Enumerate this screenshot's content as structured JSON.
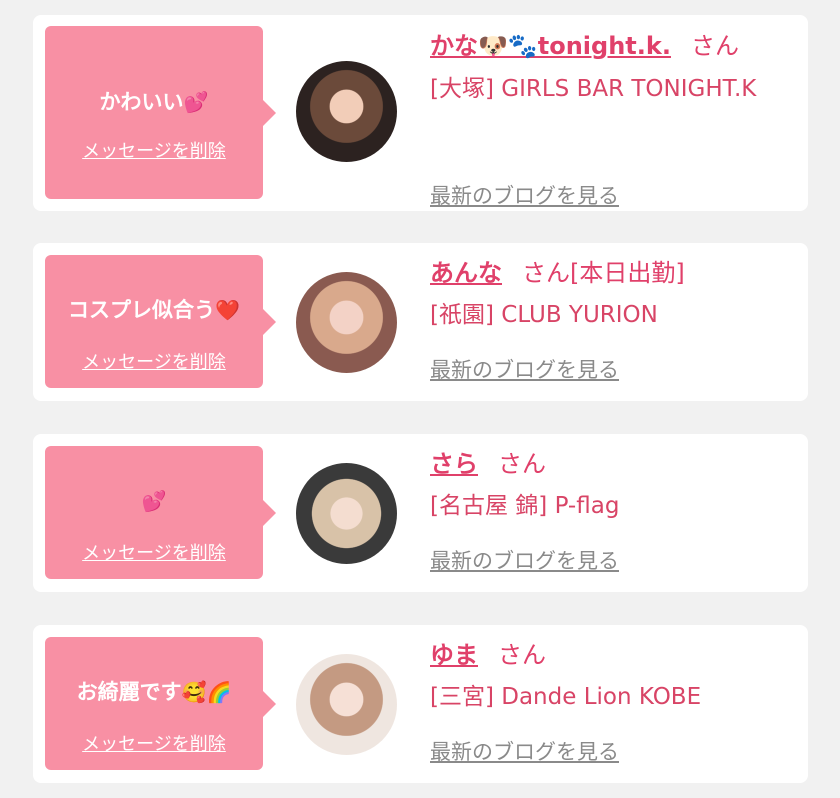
{
  "cards": [
    {
      "message": "かわいい",
      "message_emoji": "💕",
      "delete_label": "メッセージを削除",
      "name": "かな🐶🐾tonight.k.",
      "honorific": "さん",
      "status": "",
      "shop": "[大塚] GIRLS BAR TONIGHT.K",
      "blog_label": "最新のブログを見る"
    },
    {
      "message": "コスプレ似合う",
      "message_emoji": "❤️",
      "delete_label": "メッセージを削除",
      "name": "あんな",
      "honorific": "さん",
      "status": "[本日出勤]",
      "shop": "[祇園] CLUB YURION",
      "blog_label": "最新のブログを見る"
    },
    {
      "message": "",
      "message_emoji": "💕",
      "delete_label": "メッセージを削除",
      "name": "さら",
      "honorific": "さん",
      "status": "",
      "shop": "[名古屋 錦] P-flag",
      "blog_label": "最新のブログを見る"
    },
    {
      "message": "お綺麗です",
      "message_emoji": "🥰🌈",
      "delete_label": "メッセージを削除",
      "name": "ゆま",
      "honorific": "さん",
      "status": "",
      "shop": "[三宮] Dande Lion KOBE",
      "blog_label": "最新のブログを見る"
    }
  ],
  "colors": {
    "background": "#f1f1f1",
    "card": "#ffffff",
    "bubble": "#f890a4",
    "accent_pink": "#e0406a",
    "link_gray": "#8a8a8a"
  }
}
